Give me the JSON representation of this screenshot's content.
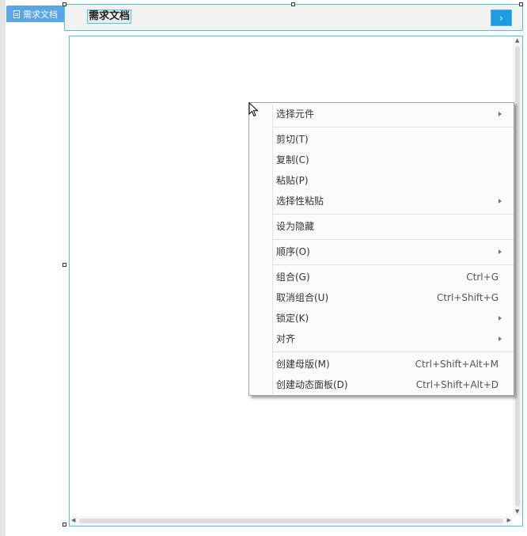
{
  "sidebar": {
    "tab_label": "需求文档"
  },
  "header": {
    "title": "需求文档",
    "next_button_glyph": "›"
  },
  "context_menu": {
    "items": [
      {
        "label": "选择元件",
        "shortcut": "",
        "submenu": true
      },
      {
        "label": "剪切(T)",
        "shortcut": "",
        "submenu": false
      },
      {
        "label": "复制(C)",
        "shortcut": "",
        "submenu": false
      },
      {
        "label": "粘贴(P)",
        "shortcut": "",
        "submenu": false
      },
      {
        "label": "选择性粘贴",
        "shortcut": "",
        "submenu": true
      },
      {
        "label": "设为隐藏",
        "shortcut": "",
        "submenu": false
      },
      {
        "label": "顺序(O)",
        "shortcut": "",
        "submenu": true
      },
      {
        "label": "组合(G)",
        "shortcut": "Ctrl+G",
        "submenu": false
      },
      {
        "label": "取消组合(U)",
        "shortcut": "Ctrl+Shift+G",
        "submenu": false
      },
      {
        "label": "锁定(K)",
        "shortcut": "",
        "submenu": true
      },
      {
        "label": "对齐",
        "shortcut": "",
        "submenu": true
      },
      {
        "label": "创建母版(M)",
        "shortcut": "Ctrl+Shift+Alt+M",
        "submenu": false
      },
      {
        "label": "创建动态面板(D)",
        "shortcut": "Ctrl+Shift+Alt+D",
        "submenu": false
      }
    ]
  },
  "colors": {
    "accent": "#1e9be3",
    "selection_border": "#4dc6dc",
    "tab_bg": "#5aa5e6"
  },
  "icons": {
    "tab": "document-icon",
    "cursor": "mouse-pointer-icon",
    "next": "chevron-right-icon"
  }
}
